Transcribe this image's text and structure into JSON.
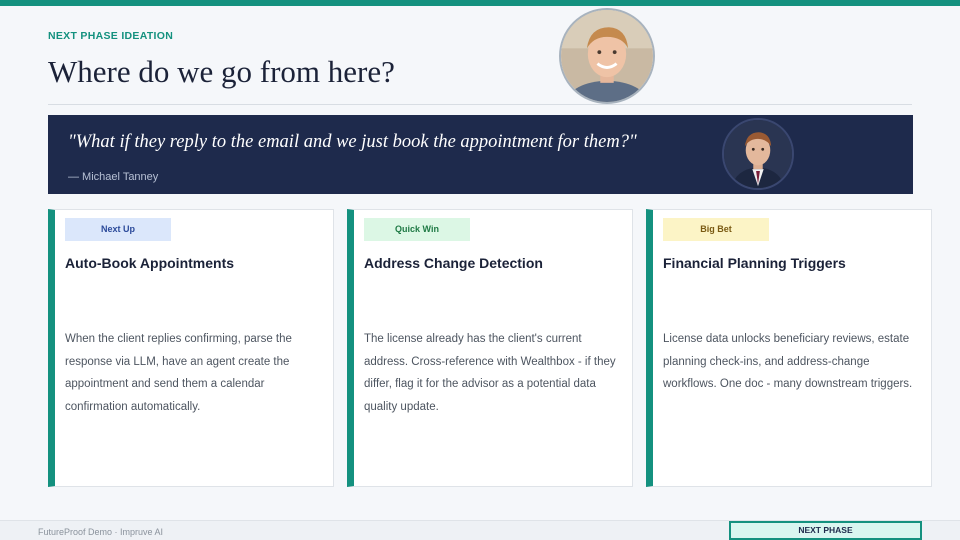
{
  "header": {
    "eyebrow": "NEXT PHASE IDEATION",
    "title": "Where do we go from here?"
  },
  "quote": {
    "text": "\"What if they reply to the email and we just book the appointment for them?\"",
    "author": "— Michael Tanney"
  },
  "cards": [
    {
      "badge": "Next Up",
      "badge_bg": "#dbe7fb",
      "badge_color": "#2b4a9a",
      "title": "Auto-Book Appointments",
      "body": "When the client replies confirming, parse the response via LLM, have an agent create the appointment and send them a calendar confirmation automatically."
    },
    {
      "badge": "Quick Win",
      "badge_bg": "#dcf7e5",
      "badge_color": "#1f7a45",
      "title": "Address Change Detection",
      "body": "The license already has the client's current address. Cross-reference with Wealthbox - if they differ, flag it for the advisor as a potential data quality update."
    },
    {
      "badge": "Big Bet",
      "badge_bg": "#fcf4c6",
      "badge_color": "#7a5a12",
      "title": "Financial Planning Triggers",
      "body": "License data unlocks beneficiary reviews, estate planning check-ins, and address-change workflows. One doc - many downstream triggers."
    }
  ],
  "footer": {
    "text": "FutureProof Demo  ·  Impruve AI",
    "button_label": "NEXT PHASE"
  },
  "colors": {
    "accent": "#14917f",
    "navy": "#1e2a4c"
  },
  "icons": {
    "presenter_photo": "presenter-photo",
    "quote_author_photo": "quote-author-photo"
  }
}
